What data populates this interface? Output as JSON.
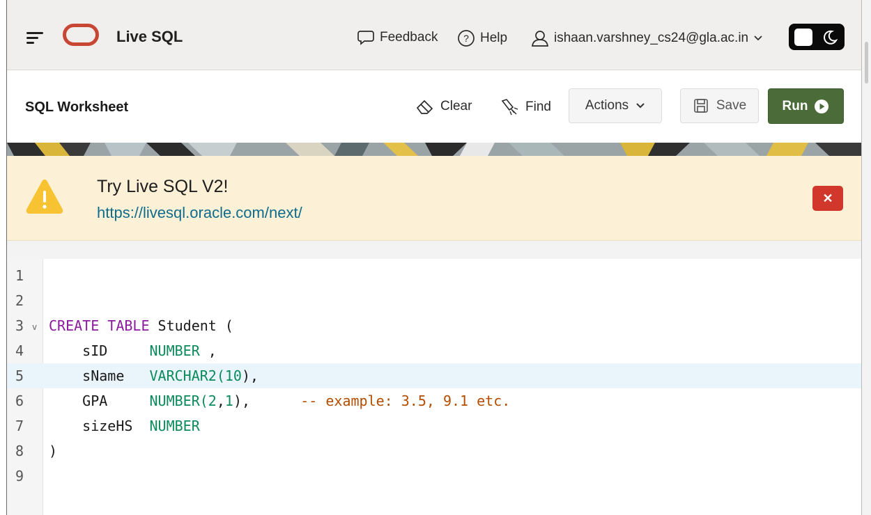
{
  "app": {
    "title": "Live SQL",
    "brand_color": "#c74634",
    "menu_icon": "hamburger-menu-icon",
    "logo_icon": "oracle-logo"
  },
  "header": {
    "feedback_label": "Feedback",
    "help_label": "Help",
    "user_label": "ishaan.varshney_cs24@gla.ac.in",
    "theme_toggle_icon": "moon-icon"
  },
  "toolbar": {
    "title": "SQL Worksheet",
    "clear_label": "Clear",
    "find_label": "Find",
    "actions_label": "Actions",
    "save_label": "Save",
    "run_label": "Run",
    "run_color": "#4b6b39"
  },
  "notice": {
    "title": "Try Live SQL V2!",
    "link": "https://livesql.oracle.com/next/",
    "close_symbol": "✕",
    "warning_color": "#f7c333",
    "close_color": "#d1372a"
  },
  "editor": {
    "active_line": 5,
    "lines": [
      {
        "num": "1",
        "tokens": []
      },
      {
        "num": "2",
        "tokens": []
      },
      {
        "num": "3",
        "fold": "v",
        "tokens": [
          {
            "t": "CREATE TABLE",
            "c": "kw"
          },
          {
            "t": " Student (",
            "c": "pl"
          }
        ]
      },
      {
        "num": "4",
        "tokens": [
          {
            "t": "    sID     ",
            "c": "pl"
          },
          {
            "t": "NUMBER",
            "c": "ty"
          },
          {
            "t": " ,",
            "c": "pl"
          }
        ]
      },
      {
        "num": "5",
        "tokens": [
          {
            "t": "    sName   ",
            "c": "pl"
          },
          {
            "t": "VARCHAR2(",
            "c": "ty"
          },
          {
            "t": "10",
            "c": "num"
          },
          {
            "t": "),",
            "c": "pl"
          }
        ]
      },
      {
        "num": "6",
        "tokens": [
          {
            "t": "    GPA     ",
            "c": "pl"
          },
          {
            "t": "NUMBER(",
            "c": "ty"
          },
          {
            "t": "2",
            "c": "num"
          },
          {
            "t": ",",
            "c": "pl"
          },
          {
            "t": "1",
            "c": "num"
          },
          {
            "t": "),      ",
            "c": "pl"
          },
          {
            "t": "-- example: 3.5, 9.1 etc.",
            "c": "cm"
          }
        ]
      },
      {
        "num": "7",
        "tokens": [
          {
            "t": "    sizeHS  ",
            "c": "pl"
          },
          {
            "t": "NUMBER",
            "c": "ty"
          }
        ]
      },
      {
        "num": "8",
        "tokens": [
          {
            "t": ")",
            "c": "pl"
          }
        ]
      },
      {
        "num": "9",
        "tokens": []
      }
    ]
  }
}
